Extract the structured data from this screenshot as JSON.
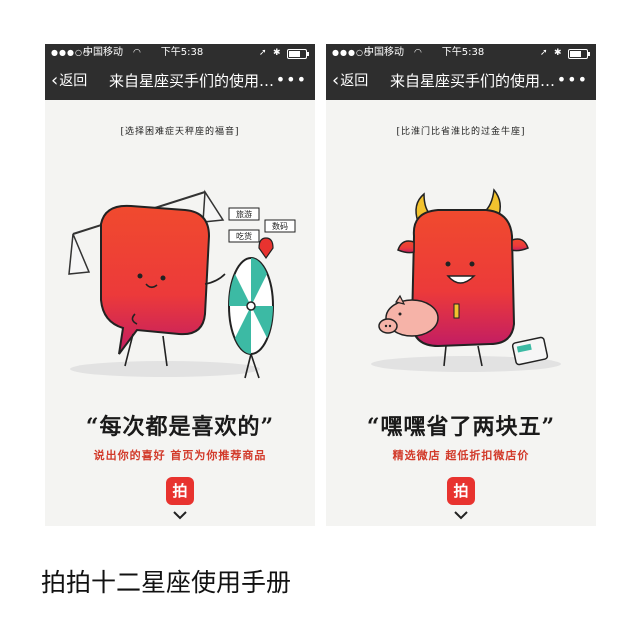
{
  "status_bar": {
    "carrier": "中国移动",
    "time": "下午5:38",
    "battery_level": 0.7
  },
  "nav": {
    "back_label": "返回",
    "title": "来自星座买手们的使用…",
    "more_label": "•••"
  },
  "phones": [
    {
      "subtitle": "[选择困难症天秤座的福音]",
      "tags": [
        "旅游",
        "数码",
        "吃货"
      ],
      "quote": "“每次都是喜欢的”",
      "slogan": "说出你的喜好  首页为你推荐商品",
      "app_icon_label": "拍"
    },
    {
      "subtitle": "[比淮门比省淮比的过金牛座]",
      "quote": "“嘿嘿省了两块五”",
      "slogan": "精选微店  超低折扣微店价",
      "app_icon_label": "拍"
    }
  ],
  "caption": "拍拍十二星座使用手册",
  "colors": {
    "status_bar_bg": "#2e2e2e",
    "accent_red": "#e8332f",
    "slogan_red": "#d23a2a",
    "page_bg": "#f4f4f2"
  }
}
